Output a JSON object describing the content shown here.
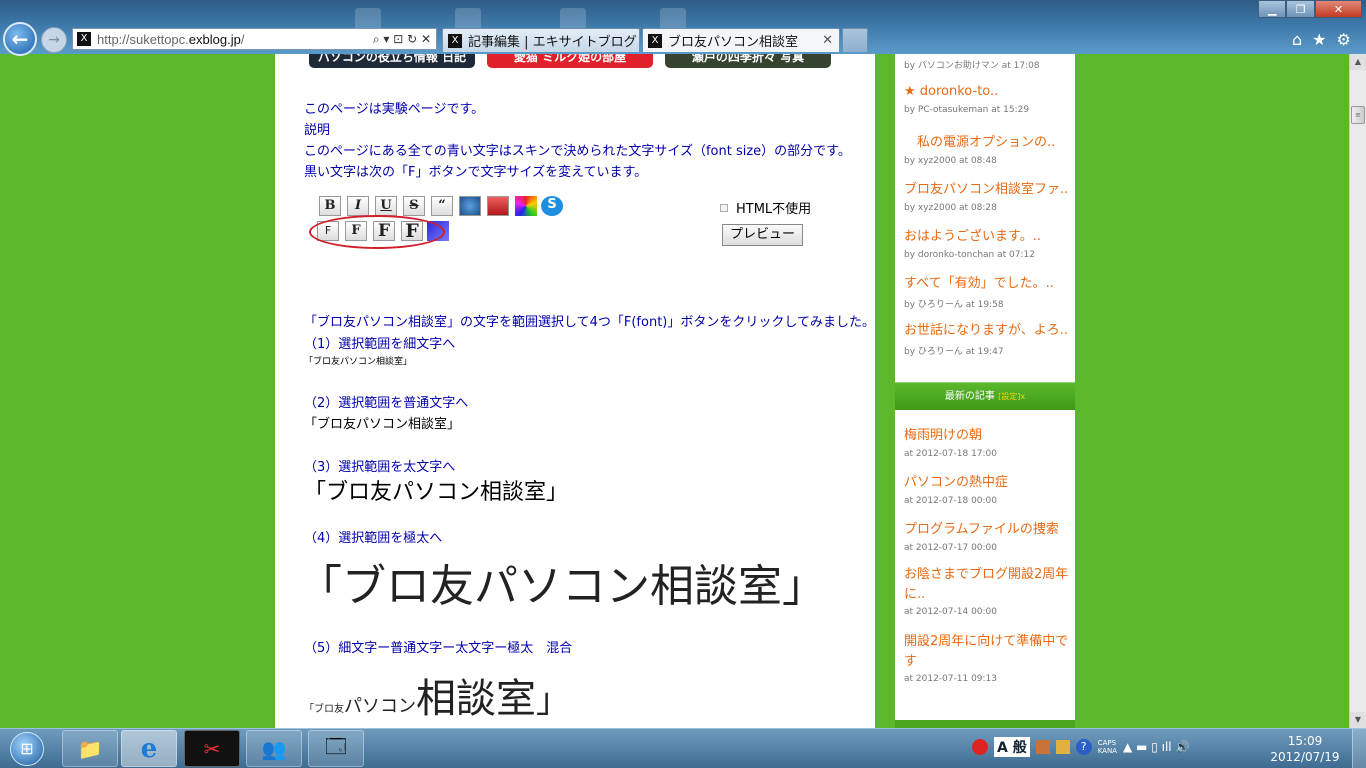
{
  "browser": {
    "url_prefix": "http://sukettopc.",
    "url_domain": "exblog.jp",
    "url_suffix": "/",
    "addr_tools": "⌕ ▾ ⊡ ↻ ✕",
    "tab1_label": "記事編集 | エキサイトブログ",
    "tab2_label": "ブロ友パソコン相談室",
    "tab_close": "✕",
    "favicon": "X"
  },
  "window": {
    "minimize": "▁",
    "maximize": "❐",
    "close": "✕"
  },
  "top_right_icons": {
    "home": "⌂",
    "favorites": "★",
    "tools": "⚙"
  },
  "main": {
    "banners": [
      "パソコンの役立ち情報 日記",
      "愛猫 ミルク姫の部屋",
      "瀬戸の四季折々 写真"
    ],
    "intro": [
      "このページは実験ページです。",
      "説明",
      "このページにある全ての青い文字はスキンで決められた文字サイズ（font size）の部分です。",
      "黒い文字は次の「F」ボタンで文字サイズを変えています。"
    ],
    "toolbar_row1": [
      "B",
      "I",
      "U",
      "S",
      "“"
    ],
    "toolbar_row2": [
      "F",
      "F",
      "F",
      "F"
    ],
    "html_option": "HTML不使用",
    "preview_button": "プレビュー",
    "desc": "「ブロ友パソコン相談室」の文字を範囲選択して4つ「F(font)」ボタンをクリックしてみました。",
    "s1_heading": "（1）選択範囲を細文字へ",
    "s1_sample": "「ブロ友パソコン相談室」",
    "s2_heading": "（2）選択範囲を普通文字へ",
    "s2_sample": "「ブロ友パソコン相談室」",
    "s3_heading": "（3）選択範囲を太文字へ",
    "s3_sample": "「ブロ友パソコン相談室」",
    "s4_heading": "（4）選択範囲を極太へ",
    "s4_sample": "「ブロ友パソコン相談室」",
    "s5_heading": "（5）細文字ー普通文字ー太文字ー極太　混合",
    "s5_part1": "「ブロ友",
    "s5_part2": "パソコン",
    "s5_part3": "相談室",
    "s5_part4": "」"
  },
  "sidebar": {
    "comments": [
      {
        "title": "",
        "meta": "by パソコンお助けマン at 17:08"
      },
      {
        "title": "★ doronko-to..",
        "meta": "by PC-otasukeman at 15:29"
      },
      {
        "title": "　私の電源オプションの..",
        "meta": "by xyz2000 at 08:48"
      },
      {
        "title": "ブロ友パソコン相談室ファ..",
        "meta": "by xyz2000 at 08:28"
      },
      {
        "title": "おはようございます。..",
        "meta": "by doronko-tonchan at 07:12"
      },
      {
        "title": "すべて「有効」でした。..",
        "meta": "by ひろりーん at 19:58"
      },
      {
        "title": "お世話になりますが、よろ..",
        "meta": "by ひろりーん at 19:47"
      }
    ],
    "latest_title": "最新の記事",
    "latest_setting": "[設定]x",
    "posts": [
      {
        "title": "梅雨明けの朝",
        "meta": "at 2012-07-18 17:00"
      },
      {
        "title": "パソコンの熱中症",
        "meta": "at 2012-07-18 00:00"
      },
      {
        "title": "プログラムファイルの捜索",
        "meta": "at 2012-07-17 00:00"
      },
      {
        "title": "お陰さまでブログ開設2周年に..",
        "meta": "at 2012-07-14 00:00"
      },
      {
        "title": "開設2周年に向けて準備中です",
        "meta": "at 2012-07-11 09:13"
      }
    ]
  },
  "scroll": {
    "up": "▲",
    "thumb": "≡",
    "down": "▼"
  },
  "taskbar": {
    "start": "⊞",
    "apps": [
      "📁",
      "e",
      "✂",
      "👥",
      "🗔"
    ],
    "ime": "A 般",
    "caps": "CAPS",
    "kana": "KANA",
    "tray_icons": "▲ ▬ ▯ ıll 🔊",
    "time": "15:09",
    "date": "2012/07/19"
  },
  "colors": {
    "page_bg": "#5cb82b",
    "link": "#e86a12",
    "annotation": "#d0202a"
  }
}
